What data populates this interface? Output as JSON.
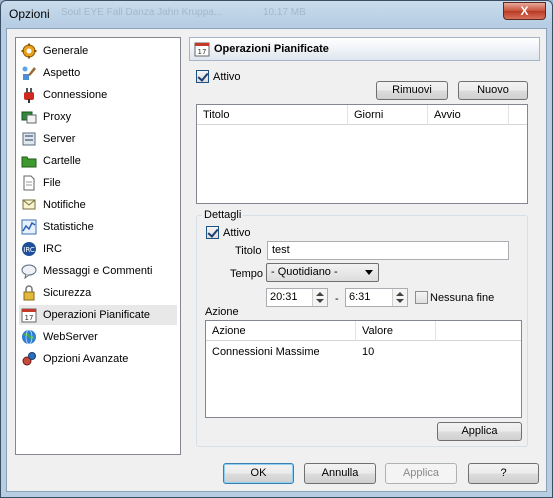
{
  "window": {
    "title": "Opzioni",
    "close_glyph": "X",
    "ghost_a": "Soul  EYE  Fall Danza  Jahn Kruppa...",
    "ghost_b": "10,17 MB"
  },
  "sidebar": {
    "items": [
      {
        "label": "Generale",
        "icon": "gear-icon"
      },
      {
        "label": "Aspetto",
        "icon": "paintbrush-icon"
      },
      {
        "label": "Connessione",
        "icon": "plug-icon"
      },
      {
        "label": "Proxy",
        "icon": "proxy-icon"
      },
      {
        "label": "Server",
        "icon": "server-icon"
      },
      {
        "label": "Cartelle",
        "icon": "folder-icon"
      },
      {
        "label": "File",
        "icon": "file-icon"
      },
      {
        "label": "Notifiche",
        "icon": "notification-icon"
      },
      {
        "label": "Statistiche",
        "icon": "statistics-icon"
      },
      {
        "label": "IRC",
        "icon": "irc-icon"
      },
      {
        "label": "Messaggi e Commenti",
        "icon": "messages-icon"
      },
      {
        "label": "Sicurezza",
        "icon": "lock-icon"
      },
      {
        "label": "Operazioni Pianificate",
        "icon": "calendar-icon"
      },
      {
        "label": "WebServer",
        "icon": "globe-icon"
      },
      {
        "label": "Opzioni Avanzate",
        "icon": "advanced-icon"
      }
    ],
    "selected": "Operazioni Pianificate"
  },
  "panel": {
    "title": "Operazioni Pianificate",
    "active_label": "Attivo",
    "active_checked": true,
    "remove_button": "Rimuovi",
    "new_button": "Nuovo",
    "tasks_table": {
      "columns": [
        "Titolo",
        "Giorni",
        "Avvio"
      ],
      "rows": []
    }
  },
  "details": {
    "group_label": "Dettagli",
    "active_label": "Attivo",
    "active_checked": true,
    "title_label": "Titolo",
    "title_value": "test",
    "time_label": "Tempo",
    "time_select_value": "- Quotidiano -",
    "start_time": "20:31",
    "separator": "-",
    "end_time": "6:31",
    "no_end_label": "Nessuna fine",
    "no_end_checked": false,
    "action_label": "Azione",
    "actions_table": {
      "columns": [
        "Azione",
        "Valore"
      ],
      "rows": [
        {
          "azione": "Connessioni Massime",
          "valore": "10"
        }
      ]
    },
    "apply_button": "Applica"
  },
  "footer": {
    "ok": "OK",
    "cancel": "Annulla",
    "apply": "Applica",
    "help": "?"
  }
}
